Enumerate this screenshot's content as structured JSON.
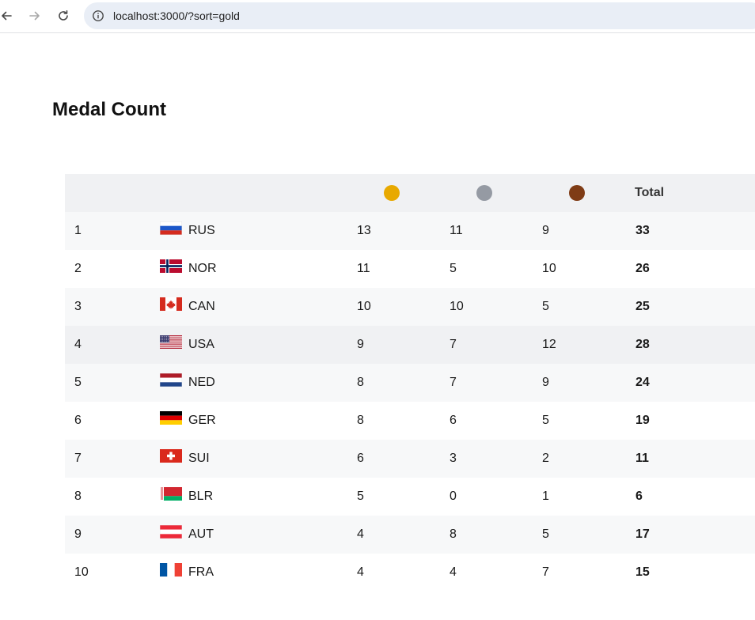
{
  "browser": {
    "url": "localhost:3000/?sort=gold"
  },
  "page": {
    "title": "Medal Count"
  },
  "table": {
    "headers": {
      "total": "Total"
    },
    "medal_colors": {
      "gold": "#e8a900",
      "silver": "#959aa3",
      "bronze": "#7f3c16"
    },
    "rows": [
      {
        "rank": "1",
        "code": "RUS",
        "flag": "russia-flag",
        "gold": "13",
        "silver": "11",
        "bronze": "9",
        "total": "33"
      },
      {
        "rank": "2",
        "code": "NOR",
        "flag": "norway-flag",
        "gold": "11",
        "silver": "5",
        "bronze": "10",
        "total": "26"
      },
      {
        "rank": "3",
        "code": "CAN",
        "flag": "canada-flag",
        "gold": "10",
        "silver": "10",
        "bronze": "5",
        "total": "25"
      },
      {
        "rank": "4",
        "code": "USA",
        "flag": "usa-flag",
        "gold": "9",
        "silver": "7",
        "bronze": "12",
        "total": "28"
      },
      {
        "rank": "5",
        "code": "NED",
        "flag": "netherlands-flag",
        "gold": "8",
        "silver": "7",
        "bronze": "9",
        "total": "24"
      },
      {
        "rank": "6",
        "code": "GER",
        "flag": "germany-flag",
        "gold": "8",
        "silver": "6",
        "bronze": "5",
        "total": "19"
      },
      {
        "rank": "7",
        "code": "SUI",
        "flag": "switzerland-flag",
        "gold": "6",
        "silver": "3",
        "bronze": "2",
        "total": "11"
      },
      {
        "rank": "8",
        "code": "BLR",
        "flag": "belarus-flag",
        "gold": "5",
        "silver": "0",
        "bronze": "1",
        "total": "6"
      },
      {
        "rank": "9",
        "code": "AUT",
        "flag": "austria-flag",
        "gold": "4",
        "silver": "8",
        "bronze": "5",
        "total": "17"
      },
      {
        "rank": "10",
        "code": "FRA",
        "flag": "france-flag",
        "gold": "4",
        "silver": "4",
        "bronze": "7",
        "total": "15"
      }
    ]
  }
}
